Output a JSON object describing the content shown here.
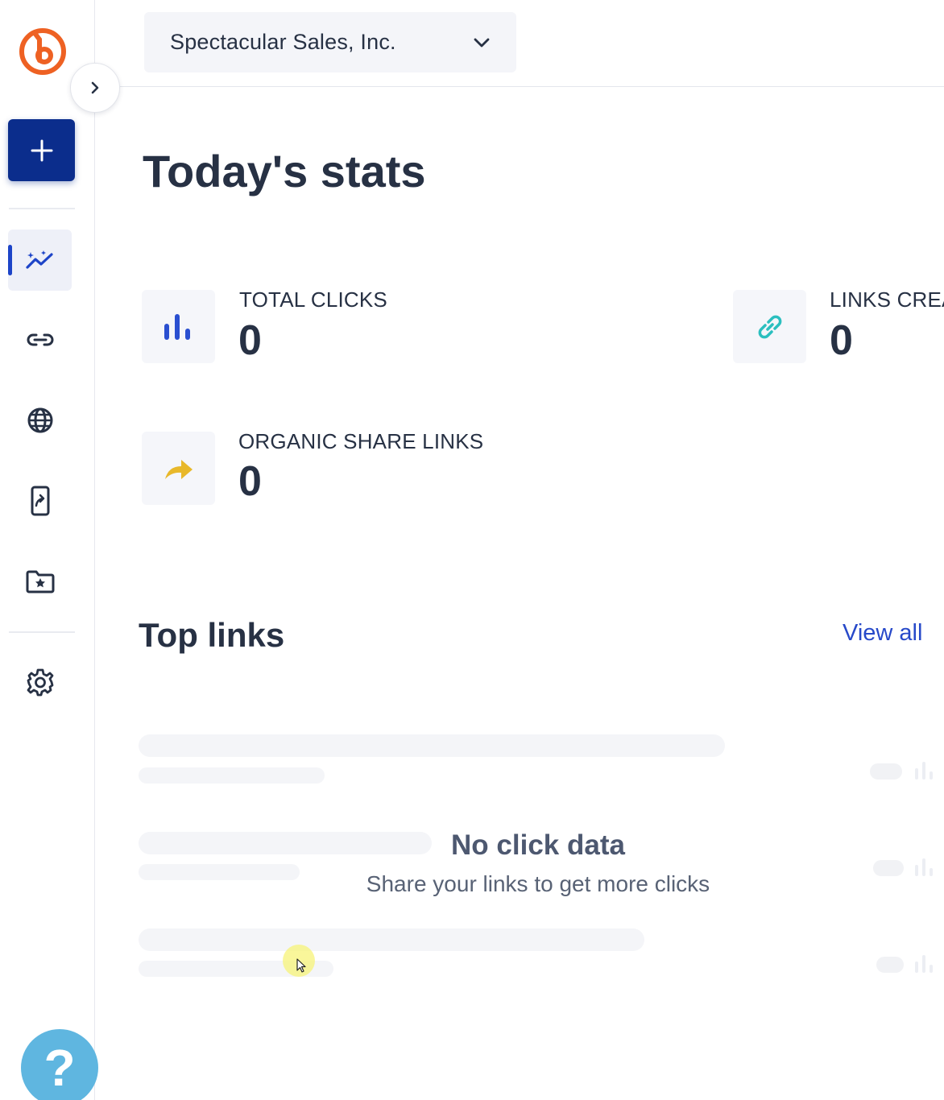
{
  "app": {
    "brand_colors": {
      "logo": "#ee6123",
      "primary": "#0b2d8c",
      "accent": "#1d44c8",
      "link": "#2749c9",
      "help": "#5fb6e0"
    }
  },
  "sidebar": {
    "logo_icon": "bitly-logo-icon",
    "collapse_icon": "chevron-right-icon",
    "create_icon": "plus-icon",
    "items": [
      {
        "name": "analytics",
        "icon": "sparkle-chart-icon",
        "active": true
      },
      {
        "name": "links",
        "icon": "link-icon",
        "active": false
      },
      {
        "name": "domains",
        "icon": "globe-icon",
        "active": false
      },
      {
        "name": "mobile-links",
        "icon": "mobile-share-icon",
        "active": false
      },
      {
        "name": "campaigns",
        "icon": "folder-star-icon",
        "active": false
      },
      {
        "name": "settings",
        "icon": "gear-icon",
        "active": false
      }
    ],
    "help_label": "?"
  },
  "header": {
    "org_name": "Spectacular Sales, Inc.",
    "org_dropdown_icon": "chevron-down-icon"
  },
  "main": {
    "title": "Today's stats",
    "stats": [
      {
        "label": "TOTAL CLICKS",
        "value": "0",
        "icon": "bar-chart-icon",
        "icon_color": "#2a4fd0"
      },
      {
        "label": "LINKS CREA",
        "value": "0",
        "icon": "link-icon",
        "icon_color": "#2bbfbf"
      },
      {
        "label": "ORGANIC SHARE LINKS",
        "value": "0",
        "icon": "share-arrow-icon",
        "icon_color": "#e8b82a"
      }
    ],
    "top_links": {
      "title": "Top links",
      "view_all": "View all",
      "empty_title": "No click data",
      "empty_subtitle": "Share your links to get more clicks"
    }
  }
}
